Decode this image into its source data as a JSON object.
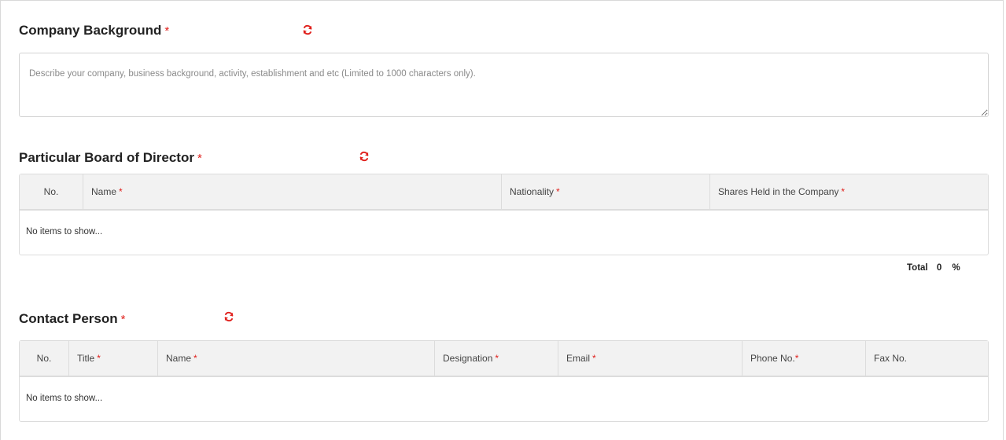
{
  "company_background": {
    "title": "Company Background",
    "required_mark": "*",
    "placeholder": "Describe your company, business background, activity, establishment and etc (Limited to 1000 characters only).",
    "value": ""
  },
  "board_of_director": {
    "title": "Particular Board of Director",
    "required_mark": "*",
    "columns": [
      {
        "label": "No.",
        "required": ""
      },
      {
        "label": "Name",
        "required": "*"
      },
      {
        "label": "Nationality",
        "required": "*"
      },
      {
        "label": "Shares Held in the Company",
        "required": "*"
      }
    ],
    "empty_text": "No items to show...",
    "total_label": "Total",
    "total_value": "0",
    "total_unit": "%"
  },
  "contact_person": {
    "title": "Contact Person",
    "required_mark": "*",
    "columns": [
      {
        "label": "No.",
        "required": ""
      },
      {
        "label": "Title",
        "required": "*"
      },
      {
        "label": "Name",
        "required": "*"
      },
      {
        "label": "Designation",
        "required": "*"
      },
      {
        "label": "Email",
        "required": "*"
      },
      {
        "label": "Phone No.",
        "required": "*"
      },
      {
        "label": "Fax No.",
        "required": ""
      }
    ],
    "empty_text": "No items to show..."
  },
  "icons": {
    "refresh": "refresh-icon"
  },
  "colors": {
    "required": "#e0201c",
    "header_bg": "#f2f2f2",
    "border": "#dcdcdc"
  }
}
